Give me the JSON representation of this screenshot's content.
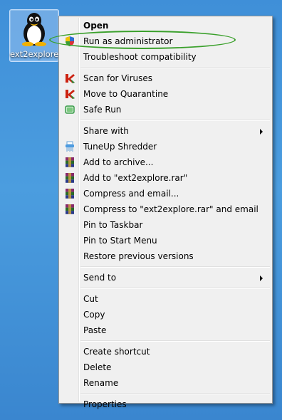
{
  "desktop_icon": {
    "label": "ext2explore",
    "icon": "tux-penguin-icon"
  },
  "context_menu": {
    "items": [
      {
        "label": "Open",
        "bold": true,
        "icon": null
      },
      {
        "label": "Run as administrator",
        "icon": "uac-shield-icon"
      },
      {
        "label": "Troubleshoot compatibility",
        "icon": null
      },
      {
        "separator": true
      },
      {
        "label": "Scan for Viruses",
        "icon": "kaspersky-icon"
      },
      {
        "label": "Move to Quarantine",
        "icon": "kaspersky-icon"
      },
      {
        "label": "Safe Run",
        "icon": "safe-run-icon"
      },
      {
        "separator": true
      },
      {
        "label": "Share with",
        "submenu": true,
        "icon": null
      },
      {
        "label": "TuneUp Shredder",
        "icon": "shredder-icon"
      },
      {
        "label": "Add to archive...",
        "icon": "winrar-icon"
      },
      {
        "label": "Add to \"ext2explore.rar\"",
        "icon": "winrar-icon"
      },
      {
        "label": "Compress and email...",
        "icon": "winrar-icon"
      },
      {
        "label": "Compress to \"ext2explore.rar\" and email",
        "icon": "winrar-icon"
      },
      {
        "label": "Pin to Taskbar",
        "icon": null
      },
      {
        "label": "Pin to Start Menu",
        "icon": null
      },
      {
        "label": "Restore previous versions",
        "icon": null
      },
      {
        "separator": true
      },
      {
        "label": "Send to",
        "submenu": true,
        "icon": null
      },
      {
        "separator": true
      },
      {
        "label": "Cut",
        "icon": null
      },
      {
        "label": "Copy",
        "icon": null
      },
      {
        "label": "Paste",
        "icon": null
      },
      {
        "separator": true
      },
      {
        "label": "Create shortcut",
        "icon": null
      },
      {
        "label": "Delete",
        "icon": null
      },
      {
        "label": "Rename",
        "icon": null
      },
      {
        "separator": true
      },
      {
        "label": "Properties",
        "icon": null
      }
    ]
  },
  "colors": {
    "desktop": "#4b9ddf",
    "menu_background": "#f0f0f0",
    "annotation": "#3aa02b"
  }
}
